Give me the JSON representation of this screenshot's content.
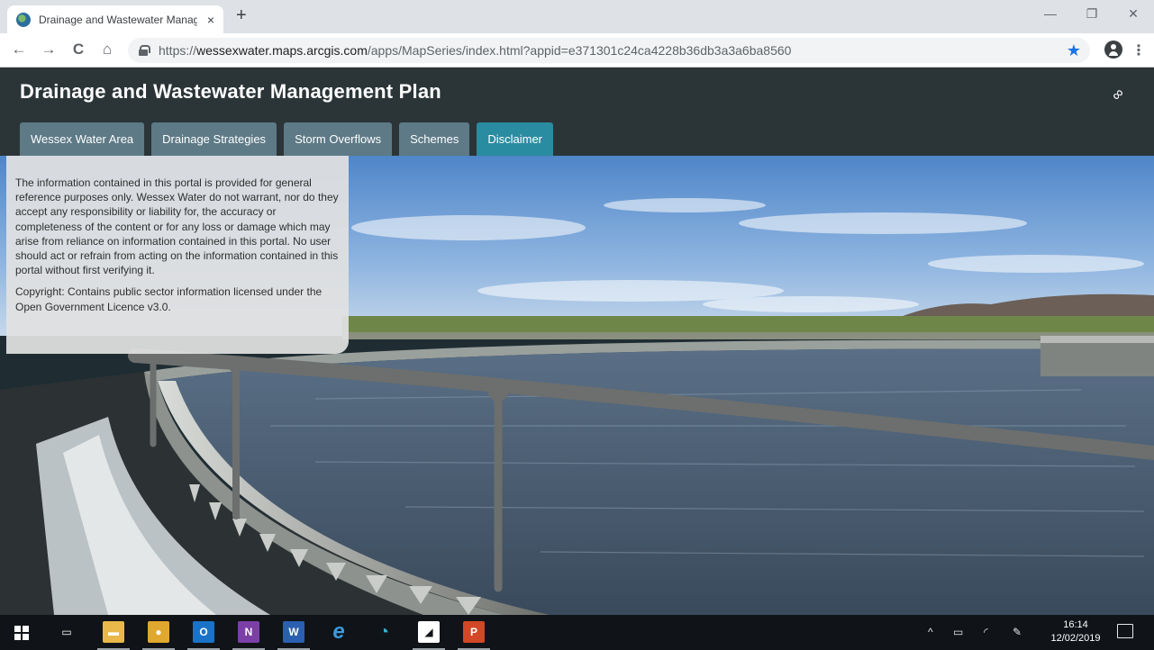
{
  "browser": {
    "tab_title": "Drainage and Wastewater Manag",
    "tab_close": "×",
    "new_tab": "+",
    "url_prefix": "https://",
    "url_host": "wessexwater.maps.arcgis.com",
    "url_path": "/apps/MapSeries/index.html?appid=e371301c24ca4228b36db3a3a6ba8560",
    "nav": {
      "back": "←",
      "forward": "→",
      "reload": "C",
      "home": "⌂"
    },
    "star": "★",
    "menu": "⋮",
    "window": {
      "minimize": "—",
      "restore": "❐",
      "close": "✕"
    }
  },
  "app": {
    "title": "Drainage and Wastewater Management Plan",
    "link_glyph": "∞",
    "tabs": [
      {
        "label": "Wessex Water Area",
        "active": false
      },
      {
        "label": "Drainage Strategies",
        "active": false
      },
      {
        "label": "Storm Overflows",
        "active": false
      },
      {
        "label": "Schemes",
        "active": false
      },
      {
        "label": "Disclaimer",
        "active": true
      }
    ]
  },
  "disclaimer": {
    "paragraph1": "The information contained in this portal is provided for general reference purposes only. Wessex Water do not warrant, nor do they accept any responsibility or liability for, the accuracy or completeness of the content or for any loss or damage which may arise from reliance on information contained in this portal. No user should act or refrain from acting on the information contained in this portal without first verifying it.",
    "paragraph2": "Copyright: Contains public sector information licensed under the Open Government Licence v3.0."
  },
  "taskbar": {
    "apps": [
      {
        "name": "task-view",
        "glyph": "▭",
        "color": "#101418"
      },
      {
        "name": "file-explorer",
        "glyph": "▬",
        "color": "#e8b84a"
      },
      {
        "name": "chrome",
        "glyph": "●",
        "color": "#e0a82e"
      },
      {
        "name": "outlook",
        "glyph": "O",
        "color": "#1a73c8"
      },
      {
        "name": "onenote",
        "glyph": "N",
        "color": "#7b3fa6"
      },
      {
        "name": "word",
        "glyph": "W",
        "color": "#2b5fb0"
      },
      {
        "name": "internet-explorer",
        "glyph": "e",
        "color": "#101418"
      },
      {
        "name": "search-app",
        "glyph": "◔",
        "color": "#101418"
      },
      {
        "name": "sticky-notes",
        "glyph": "◢",
        "color": "#ffffff"
      },
      {
        "name": "powerpoint",
        "glyph": "P",
        "color": "#d24726"
      }
    ],
    "tray": {
      "chevron": "^",
      "time": "16:14",
      "date": "12/02/2019"
    }
  }
}
